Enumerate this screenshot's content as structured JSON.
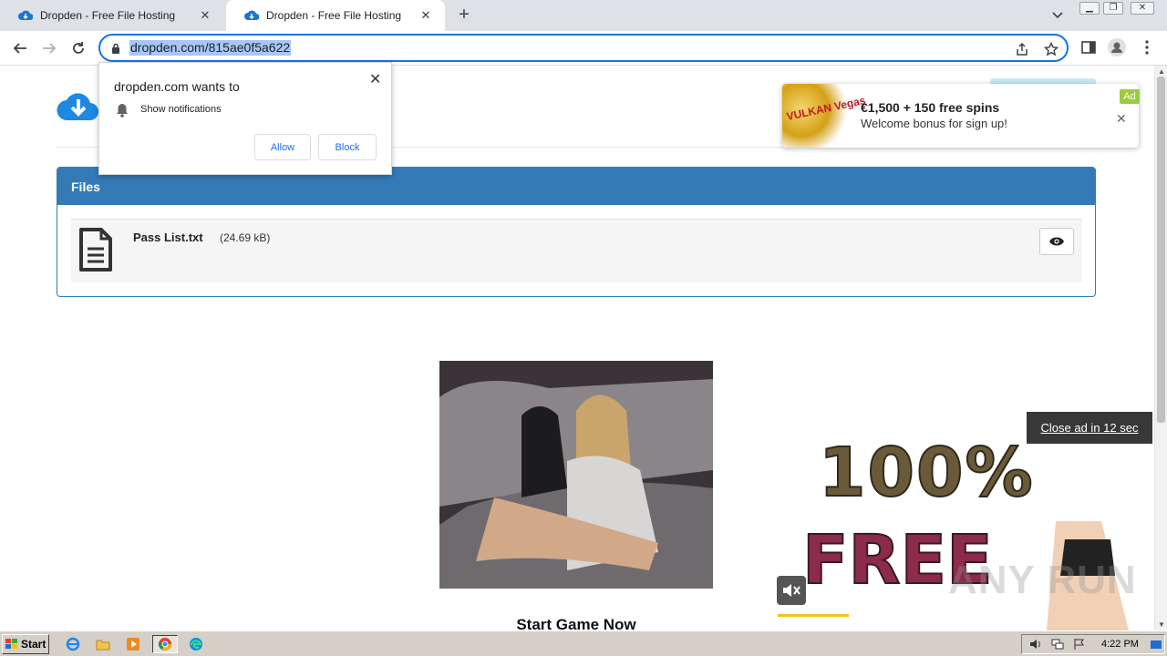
{
  "browser": {
    "tabs": [
      {
        "title": "Dropden - Free File Hosting",
        "active": false
      },
      {
        "title": "Dropden - Free File Hosting",
        "active": true
      }
    ],
    "url": "dropden.com/815ae0f5a622"
  },
  "notification": {
    "question": "dropden.com wants to",
    "permission": "Show notifications",
    "allow_label": "Allow",
    "block_label": "Block"
  },
  "files_panel": {
    "heading": "Files",
    "file_name": "Pass List.txt",
    "file_size": "(24.69 kB)"
  },
  "top_ad": {
    "thumb_text": "VULKAN Vegas",
    "headline": "€1,500 + 150 free spins",
    "subline": "Welcome bonus for sign up!",
    "tag": "Ad"
  },
  "game_ad": {
    "caption": "Start Game Now"
  },
  "video_ad": {
    "close_label": "Close ad in 12 sec",
    "line1": "100%",
    "line2": "FREE",
    "watermark": "ANY RUN"
  },
  "taskbar": {
    "start_label": "Start",
    "clock": "4:22 PM"
  },
  "colors": {
    "panel_blue": "#337ab7",
    "omnibox_focus": "#1a73e8",
    "url_selection": "#a8c7fa"
  }
}
